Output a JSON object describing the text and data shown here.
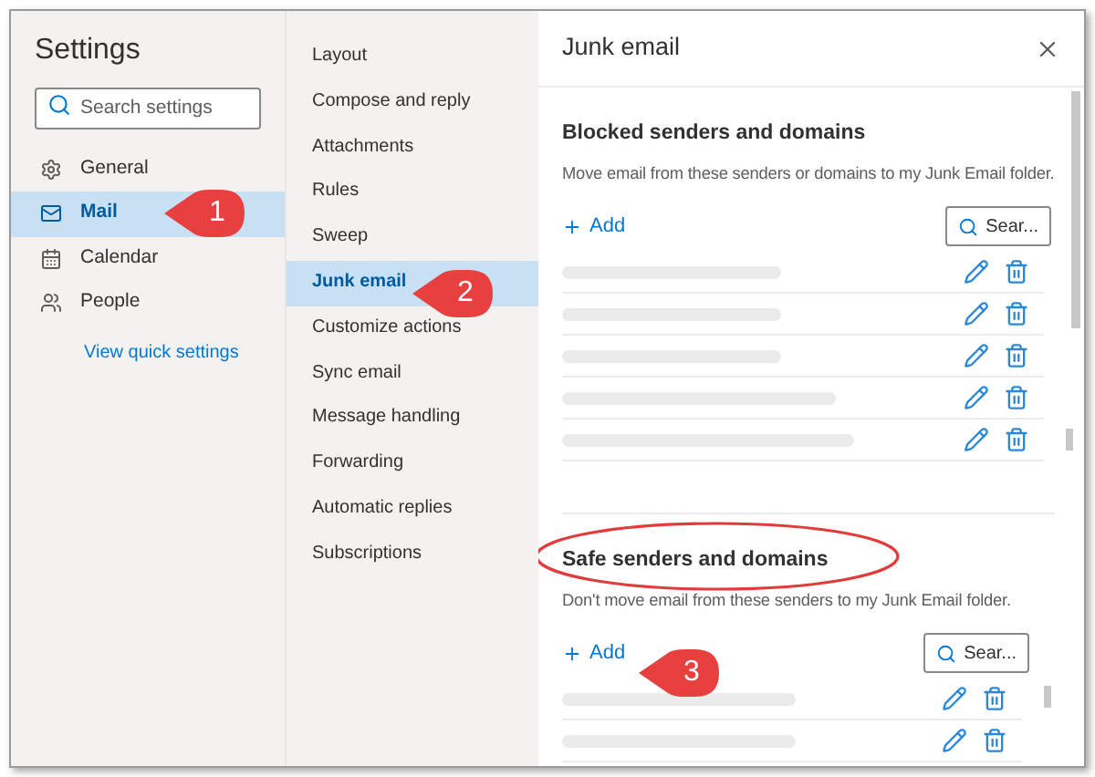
{
  "sidebar": {
    "title": "Settings",
    "search": {
      "placeholder": "Search settings"
    },
    "items": [
      {
        "label": "General",
        "selected": false
      },
      {
        "label": "Mail",
        "selected": true
      },
      {
        "label": "Calendar",
        "selected": false
      },
      {
        "label": "People",
        "selected": false
      }
    ],
    "link": "View quick settings"
  },
  "submenu": {
    "items": [
      {
        "label": "Layout",
        "selected": false
      },
      {
        "label": "Compose and reply",
        "selected": false
      },
      {
        "label": "Attachments",
        "selected": false
      },
      {
        "label": "Rules",
        "selected": false
      },
      {
        "label": "Sweep",
        "selected": false
      },
      {
        "label": "Junk email",
        "selected": true
      },
      {
        "label": "Customize actions",
        "selected": false
      },
      {
        "label": "Sync email",
        "selected": false
      },
      {
        "label": "Message handling",
        "selected": false
      },
      {
        "label": "Forwarding",
        "selected": false
      },
      {
        "label": "Automatic replies",
        "selected": false
      },
      {
        "label": "Subscriptions",
        "selected": false
      }
    ]
  },
  "panel": {
    "title": "Junk email",
    "sections": [
      {
        "heading": "Blocked senders and domains",
        "highlighted": false,
        "description": "Move email from these senders or domains to my Junk Email folder.",
        "add": "Add",
        "search": "Sear...",
        "rows": [
          {
            "kind": "redacted"
          },
          {
            "kind": "redacted"
          },
          {
            "kind": "redacted"
          },
          {
            "kind": "redacted"
          },
          {
            "kind": "redacted"
          }
        ]
      },
      {
        "heading": "Safe senders and domains",
        "highlighted": true,
        "description": "Don't move email from these senders to my Junk Email folder.",
        "add": "Add",
        "search": "Sear...",
        "rows": [
          {
            "kind": "redacted"
          },
          {
            "kind": "redacted"
          }
        ]
      }
    ]
  },
  "callouts": [
    "1",
    "2",
    "3"
  ]
}
